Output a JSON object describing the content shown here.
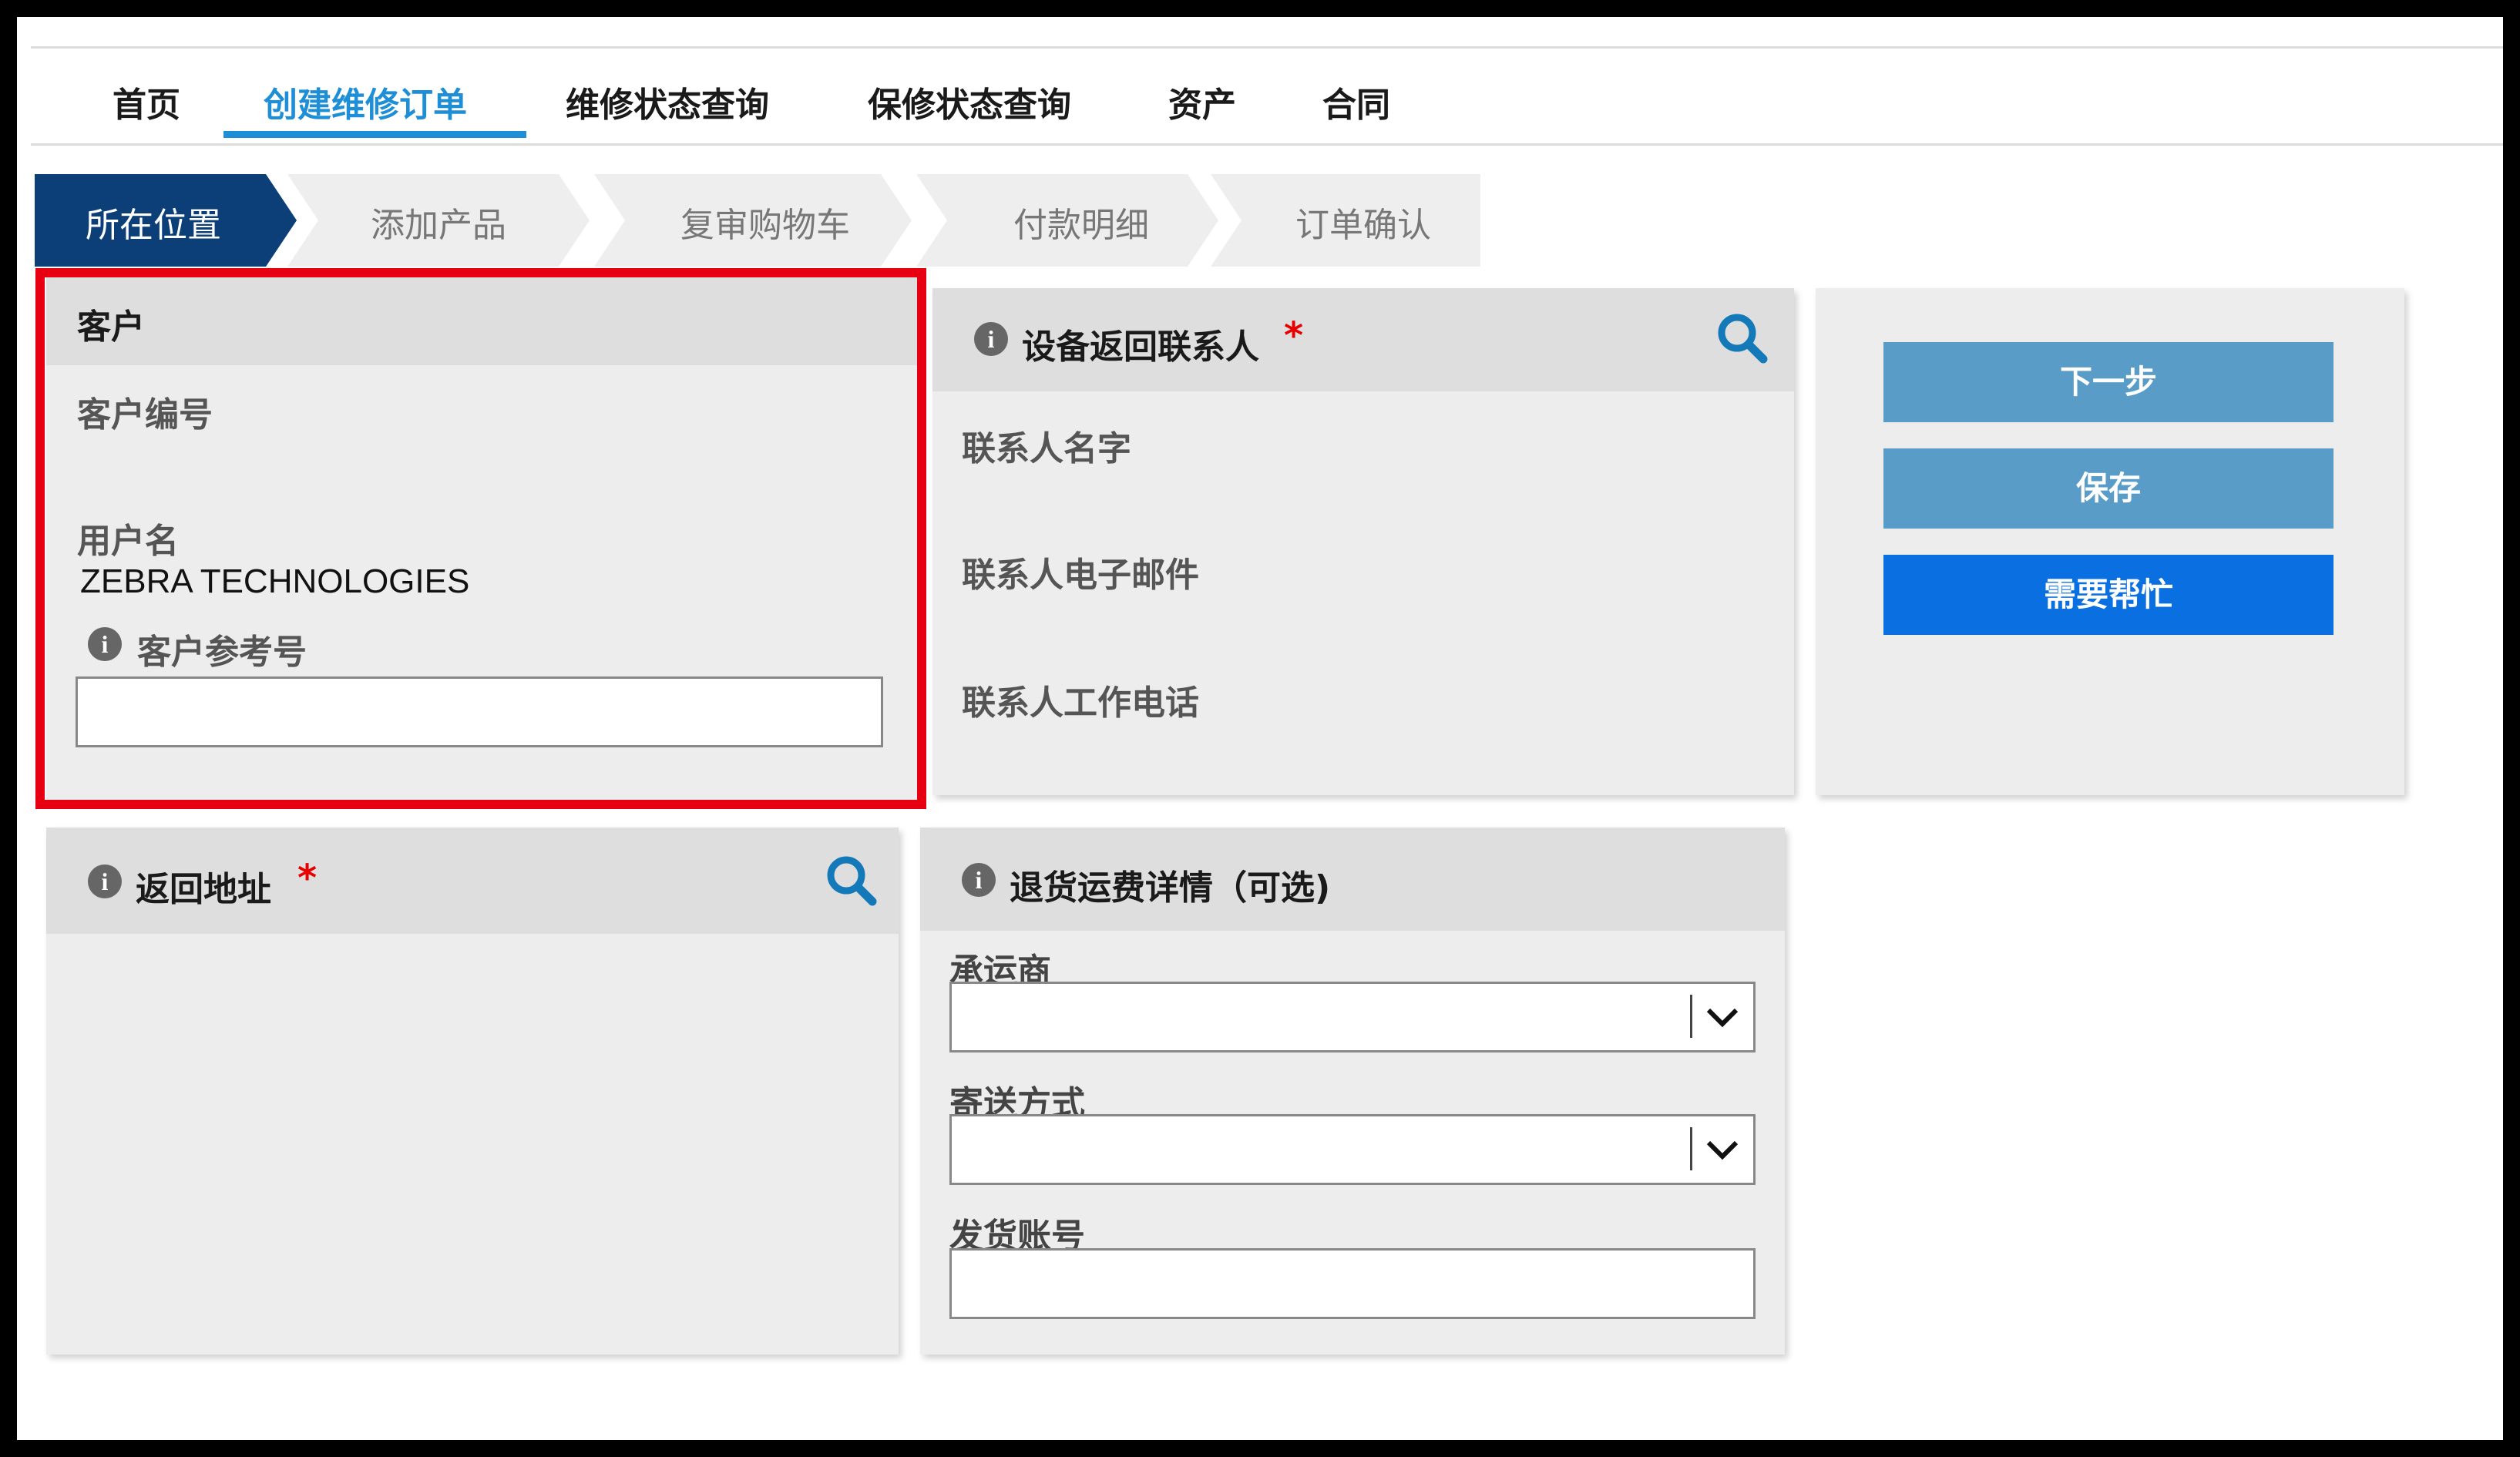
{
  "nav": {
    "items": [
      {
        "label": "首页"
      },
      {
        "label": "创建维修订单",
        "active": true
      },
      {
        "label": "维修状态查询"
      },
      {
        "label": "保修状态查询"
      },
      {
        "label": "资产"
      },
      {
        "label": "合同"
      }
    ]
  },
  "steps": [
    {
      "label": "所在位置",
      "active": true
    },
    {
      "label": "添加产品"
    },
    {
      "label": "复审购物车"
    },
    {
      "label": "付款明细"
    },
    {
      "label": "订单确认"
    }
  ],
  "customer": {
    "title": "客户",
    "number_label": "客户编号",
    "username_label": "用户名",
    "username_value": "ZEBRA TECHNOLOGIES",
    "reference_label": "客户参考号",
    "reference_value": ""
  },
  "contact": {
    "title": "设备返回联系人",
    "required_mark": "*",
    "name_label": "联系人名字",
    "email_label": "联系人电子邮件",
    "phone_label": "联系人工作电话"
  },
  "actions": {
    "next": "下一步",
    "save": "保存",
    "help": "需要帮忙"
  },
  "return_address": {
    "title": "返回地址",
    "required_mark": "*"
  },
  "shipping": {
    "title": "退货运费详情（可选)",
    "carrier_label": "承运商",
    "carrier_value": "",
    "method_label": "寄送方式",
    "method_value": "",
    "account_label": "发货账号",
    "account_value": ""
  },
  "colors": {
    "accent": "#1e8fd6",
    "step_active": "#0c3f78",
    "button_muted": "#5a9cc8",
    "button_primary": "#0a6fe0",
    "highlight_border": "#e60012",
    "required": "#e60000"
  }
}
